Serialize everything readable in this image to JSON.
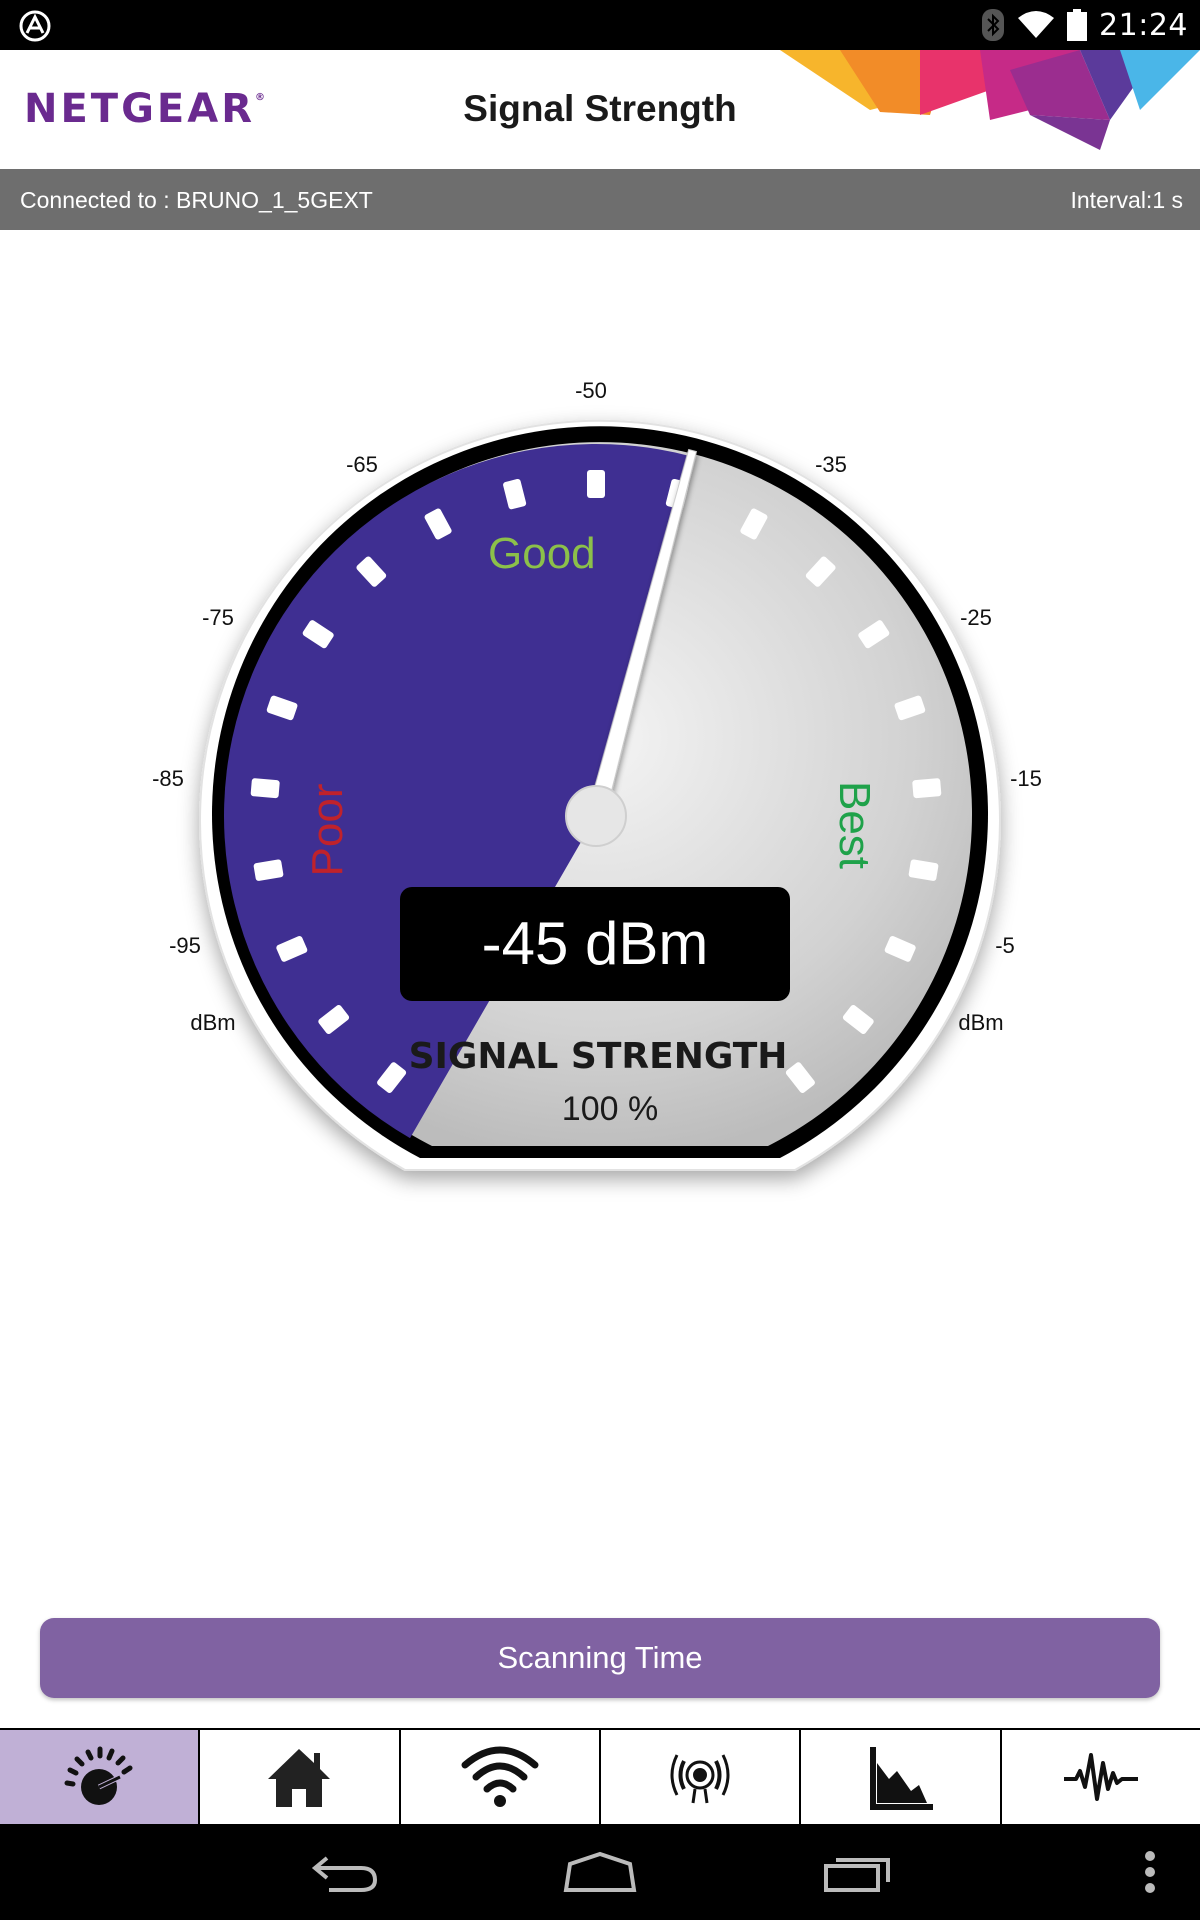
{
  "status_bar": {
    "time": "21:24",
    "icons": [
      "assistant-icon",
      "bluetooth-icon",
      "wifi-icon",
      "battery-icon"
    ]
  },
  "header": {
    "logo": "NETGEAR",
    "logo_mark": "®",
    "title": "Signal Strength"
  },
  "info_bar": {
    "connected": "Connected to : BRUNO_1_5GEXT",
    "interval": "Interval:1 s"
  },
  "gauge": {
    "reading_dbm": -45,
    "reading_text": "-45 dBm",
    "caption": "SIGNAL STRENGTH",
    "percent_text": "100 %",
    "scale_min_dbm": -100,
    "scale_max_dbm": 0,
    "ticks": [
      "-95",
      "-85",
      "-75",
      "-65",
      "-50",
      "-35",
      "-25",
      "-15",
      "-5"
    ],
    "unit_left": "dBm",
    "unit_right": "dBm",
    "zones": {
      "poor": "Poor",
      "good": "Good",
      "best": "Best"
    },
    "colors": {
      "fill": "#3f2f92",
      "poor": "#c0222b",
      "good": "#8cc04a",
      "best": "#1fa24a"
    }
  },
  "scan_button": {
    "label": "Scanning Time"
  },
  "tabs": [
    {
      "icon": "gauge-icon",
      "active": true
    },
    {
      "icon": "home-icon",
      "active": false
    },
    {
      "icon": "wifi-icon",
      "active": false
    },
    {
      "icon": "signal-broadcast-icon",
      "active": false
    },
    {
      "icon": "area-chart-icon",
      "active": false
    },
    {
      "icon": "waveform-icon",
      "active": false
    }
  ],
  "nav": [
    "back-icon",
    "home-nav-icon",
    "recents-icon",
    "overflow-menu-icon"
  ]
}
